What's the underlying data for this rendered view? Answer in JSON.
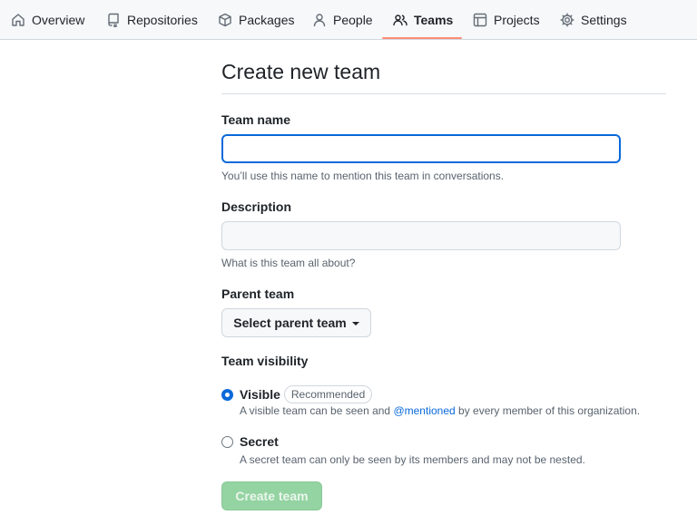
{
  "nav": {
    "items": [
      {
        "label": "Overview",
        "icon": "home-icon"
      },
      {
        "label": "Repositories",
        "icon": "repo-icon"
      },
      {
        "label": "Packages",
        "icon": "package-icon"
      },
      {
        "label": "People",
        "icon": "person-icon"
      },
      {
        "label": "Teams",
        "icon": "people-icon",
        "active": true
      },
      {
        "label": "Projects",
        "icon": "table-icon"
      },
      {
        "label": "Settings",
        "icon": "gear-icon"
      }
    ]
  },
  "page": {
    "title": "Create new team"
  },
  "form": {
    "team_name": {
      "label": "Team name",
      "value": "",
      "hint": "You’ll use this name to mention this team in conversations."
    },
    "description": {
      "label": "Description",
      "value": "",
      "hint": "What is this team all about?"
    },
    "parent_team": {
      "label": "Parent team",
      "button_label": "Select parent team"
    },
    "visibility": {
      "label": "Team visibility",
      "visible": {
        "label": "Visible",
        "badge": "Recommended",
        "note_before": "A visible team can be seen and ",
        "note_link": "@mentioned",
        "note_after": " by every member of this organization.",
        "checked": true
      },
      "secret": {
        "label": "Secret",
        "note": "A secret team can only be seen by its members and may not be nested.",
        "checked": false
      }
    },
    "submit_label": "Create team"
  },
  "colors": {
    "accent": "#0969da",
    "nav_underline": "#fd8c73",
    "submit_disabled": "#94d3a2"
  }
}
